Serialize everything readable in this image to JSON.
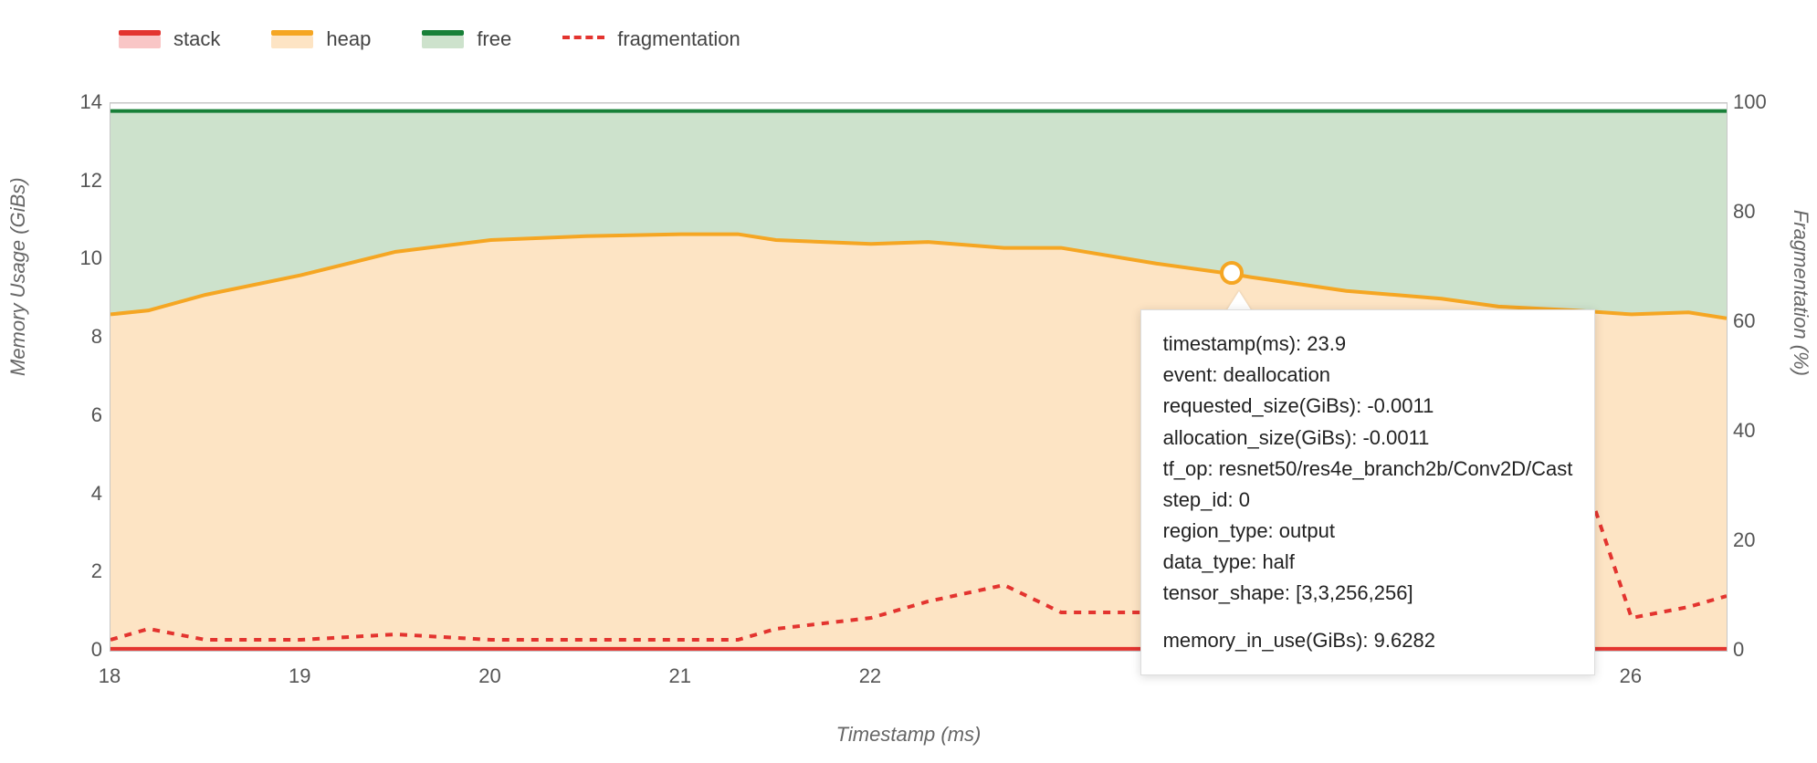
{
  "legend": {
    "stack": "stack",
    "heap": "heap",
    "free": "free",
    "fragmentation": "fragmentation"
  },
  "axes": {
    "xlabel": "Timestamp (ms)",
    "ylabel_left": "Memory Usage (GiBs)",
    "ylabel_right": "Fragmentation (%)"
  },
  "colors": {
    "stack_line": "#e3342f",
    "stack_fill": "#f9c6c6",
    "heap_line": "#f5a623",
    "heap_fill": "#fde4c4",
    "free_line": "#188038",
    "free_fill": "#cde2cc",
    "frag_line": "#e3342f"
  },
  "chart_data": {
    "type": "area",
    "xlabel": "Timestamp (ms)",
    "ylabel_left": "Memory Usage (GiBs)",
    "ylabel_right": "Fragmentation (%)",
    "xlim": [
      18,
      26.5
    ],
    "ylim_left": [
      0,
      14
    ],
    "ylim_right": [
      0,
      100
    ],
    "y_ticks_left": [
      0,
      2,
      4,
      6,
      8,
      10,
      12,
      14
    ],
    "y_ticks_right": [
      0,
      20,
      40,
      60,
      80,
      100
    ],
    "x_ticks": [
      18,
      19,
      20,
      21,
      22,
      26
    ],
    "x": [
      18.0,
      18.2,
      18.5,
      19.0,
      19.5,
      20.0,
      20.5,
      21.0,
      21.3,
      21.5,
      22.0,
      22.3,
      22.7,
      23.0,
      23.5,
      23.9,
      24.0,
      24.5,
      25.0,
      25.3,
      25.7,
      26.0,
      26.3,
      26.5
    ],
    "series": [
      {
        "name": "stack",
        "kind": "area",
        "axis": "left",
        "values": [
          0.05,
          0.05,
          0.05,
          0.05,
          0.05,
          0.05,
          0.05,
          0.05,
          0.05,
          0.05,
          0.05,
          0.05,
          0.05,
          0.05,
          0.05,
          0.05,
          0.05,
          0.05,
          0.05,
          0.05,
          0.05,
          0.05,
          0.05,
          0.05
        ]
      },
      {
        "name": "heap",
        "kind": "area",
        "axis": "left",
        "values": [
          8.6,
          8.7,
          9.1,
          9.6,
          10.2,
          10.5,
          10.6,
          10.65,
          10.65,
          10.5,
          10.4,
          10.45,
          10.3,
          10.3,
          9.9,
          9.63,
          9.55,
          9.2,
          9.0,
          8.8,
          8.7,
          8.6,
          8.65,
          8.5
        ]
      },
      {
        "name": "free",
        "kind": "area",
        "axis": "left",
        "values": [
          13.8,
          13.8,
          13.8,
          13.8,
          13.8,
          13.8,
          13.8,
          13.8,
          13.8,
          13.8,
          13.8,
          13.8,
          13.8,
          13.8,
          13.8,
          13.8,
          13.8,
          13.8,
          13.8,
          13.8,
          13.8,
          13.8,
          13.8,
          13.8
        ]
      },
      {
        "name": "fragmentation",
        "kind": "line-dashed",
        "axis": "right",
        "values": [
          2,
          4,
          2,
          2,
          3,
          2,
          2,
          2,
          2,
          4,
          6,
          9,
          12,
          7,
          7,
          7,
          7,
          7,
          7,
          7,
          37,
          6,
          8,
          10
        ]
      }
    ]
  },
  "tooltip": {
    "rows": [
      {
        "label": "timestamp(ms)",
        "value": "23.9"
      },
      {
        "label": "event",
        "value": "deallocation"
      },
      {
        "label": "requested_size(GiBs)",
        "value": "-0.0011"
      },
      {
        "label": "allocation_size(GiBs)",
        "value": "-0.0011"
      },
      {
        "label": "tf_op",
        "value": "resnet50/res4e_branch2b/Conv2D/Cast"
      },
      {
        "label": "step_id",
        "value": "0"
      },
      {
        "label": "region_type",
        "value": "output"
      },
      {
        "label": "data_type",
        "value": "half"
      },
      {
        "label": "tensor_shape",
        "value": "[3,3,256,256]"
      }
    ],
    "summary": {
      "label": "memory_in_use(GiBs)",
      "value": "9.6282"
    },
    "hover_x": 23.9,
    "hover_y_left": 9.63
  }
}
